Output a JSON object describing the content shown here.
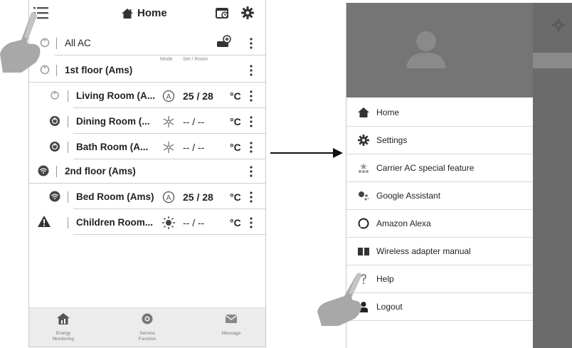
{
  "left_screen": {
    "title": "Home",
    "rows": [
      {
        "name": "All AC",
        "type": "group"
      },
      {
        "name": "1st floor (Ams)",
        "type": "group"
      },
      {
        "name": "Living Room (A...",
        "temp": "25 / 28",
        "unit": "°C",
        "mode": "auto"
      },
      {
        "name": "Dining Room (...",
        "temp": "-- / --",
        "unit": "°C",
        "mode": "cool"
      },
      {
        "name": "Bath Room (A...",
        "temp": "-- / --",
        "unit": "°C",
        "mode": "cool"
      },
      {
        "name": "2nd floor (Ams)",
        "type": "group"
      },
      {
        "name": "Bed Room (Ams)",
        "temp": "25 / 28",
        "unit": "°C",
        "mode": "auto"
      },
      {
        "name": "Children Room...",
        "temp": "-- / --",
        "unit": "°C",
        "mode": "heat"
      }
    ],
    "sub_header": {
      "mode": "Mode",
      "set_room": "Set / Room"
    },
    "bottom_tabs": [
      {
        "label_line1": "Energy",
        "label_line2": "Monitoring",
        "icon": "house-chart-icon"
      },
      {
        "label_line1": "Service",
        "label_line2": "Function",
        "icon": "service-icon"
      },
      {
        "label_line1": "Message",
        "label_line2": "",
        "icon": "envelope-icon"
      }
    ]
  },
  "right_screen": {
    "menu": [
      {
        "label": "Home",
        "icon": "home-icon"
      },
      {
        "label": "Settings",
        "icon": "gear-icon"
      },
      {
        "label": "Carrier AC special feature",
        "icon": "stars-icon"
      },
      {
        "label": "Google Assistant",
        "icon": "google-assistant-icon"
      },
      {
        "label": "Amazon Alexa",
        "icon": "alexa-icon"
      },
      {
        "label": "Wireless adapter manual",
        "icon": "book-icon"
      },
      {
        "label": "Help",
        "icon": "question-icon"
      },
      {
        "label": "Logout",
        "icon": "user-icon"
      }
    ]
  },
  "colors": {
    "overlay": "#757575",
    "text": "#222222",
    "divider": "#d8d8d8"
  }
}
